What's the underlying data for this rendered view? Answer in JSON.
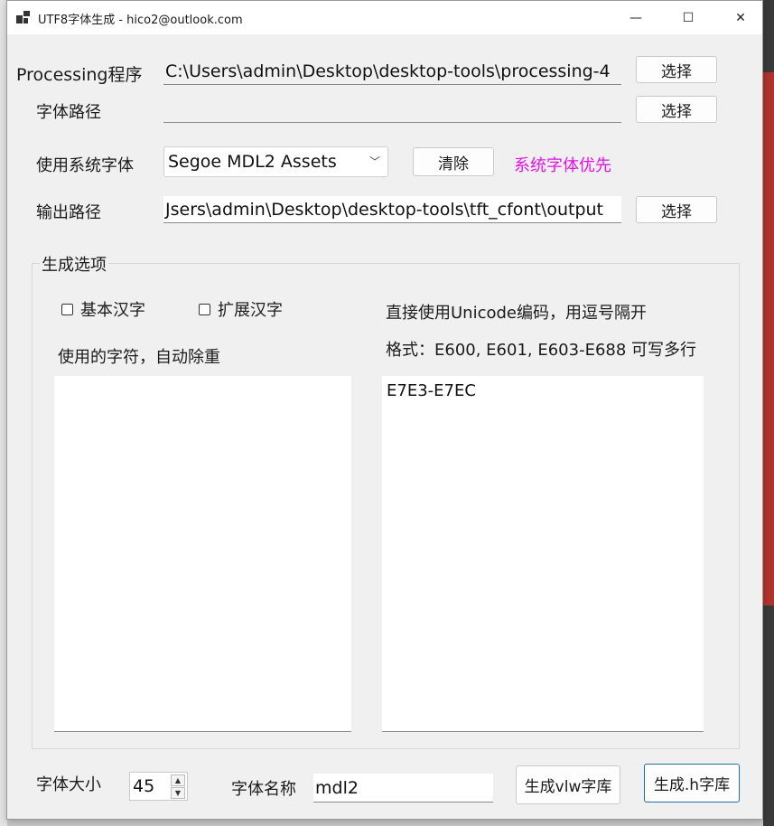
{
  "window": {
    "title": "UTF8字体生成 - hico2@outlook.com",
    "controls": {
      "minimize": "—",
      "maximize": "☐",
      "close": "✕"
    }
  },
  "processing": {
    "label": "Processing程序",
    "value": "C:\\Users\\admin\\Desktop\\desktop-tools\\processing-4",
    "button": "选择"
  },
  "font_path": {
    "label": "字体路径",
    "value": "",
    "button": "选择"
  },
  "system_font": {
    "label": "使用系统字体",
    "selected": "Segoe MDL2 Assets",
    "clear_button": "清除",
    "priority_note": "系统字体优先"
  },
  "output_path": {
    "label": "输出路径",
    "value": "Jsers\\admin\\Desktop\\desktop-tools\\tft_cfont\\output",
    "button": "选择"
  },
  "options": {
    "group_title": "生成选项",
    "basic_chinese": "基本汉字",
    "extended_chinese": "扩展汉字",
    "used_chars_label": "使用的字符，自动除重",
    "used_chars_value": "",
    "unicode_label": "直接使用Unicode编码，用逗号隔开",
    "format_label": "格式：E600, E601, E603-E688 可写多行",
    "unicode_value": "E7E3-E7EC"
  },
  "bottom": {
    "font_size_label": "字体大小",
    "font_size_value": "45",
    "font_name_label": "字体名称",
    "font_name_value": "mdl2",
    "gen_vlw_button": "生成vlw字库",
    "gen_h_button": "生成.h字库"
  },
  "colors": {
    "accent_note": "#e313e3",
    "focus_border": "#1f6fa6"
  }
}
